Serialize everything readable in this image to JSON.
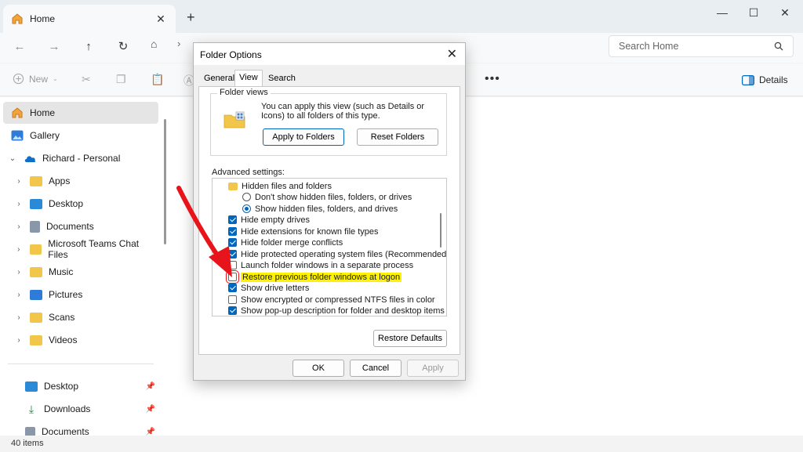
{
  "window": {
    "tab_title": "Home",
    "tab_close": "✕",
    "new_tab": "+",
    "minimize": "—",
    "maximize": "☐",
    "close": "✕"
  },
  "nav": {
    "back": "←",
    "forward": "→",
    "up": "↑",
    "refresh": "↻",
    "home": "⌂",
    "chevron": "›",
    "search_placeholder": "Search Home"
  },
  "commands": {
    "new_label": "New",
    "more": "•••",
    "details_label": "Details"
  },
  "sidebar": {
    "items": [
      {
        "label": "Home",
        "icon": "home-icon",
        "selected": true
      },
      {
        "label": "Gallery",
        "icon": "gallery-icon"
      },
      {
        "label": "Richard - Personal",
        "icon": "onedrive-icon",
        "expanded": true
      },
      {
        "label": "Apps",
        "icon": "folder-icon"
      },
      {
        "label": "Desktop",
        "icon": "desktop-icon"
      },
      {
        "label": "Documents",
        "icon": "documents-icon"
      },
      {
        "label": "Microsoft Teams Chat Files",
        "icon": "folder-icon"
      },
      {
        "label": "Music",
        "icon": "folder-icon"
      },
      {
        "label": "Pictures",
        "icon": "pictures-icon"
      },
      {
        "label": "Scans",
        "icon": "folder-icon"
      },
      {
        "label": "Videos",
        "icon": "folder-icon"
      }
    ],
    "pinned": [
      {
        "label": "Desktop",
        "icon": "desktop-icon"
      },
      {
        "label": "Downloads",
        "icon": "download-icon"
      },
      {
        "label": "Documents",
        "icon": "documents-icon"
      }
    ]
  },
  "status": {
    "item_count": "40 items"
  },
  "dialog": {
    "title": "Folder Options",
    "close": "✕",
    "tabs": [
      "General",
      "View",
      "Search"
    ],
    "active_tab": "View",
    "folder_views": {
      "legend": "Folder views",
      "description": "You can apply this view (such as Details or Icons) to all folders of this type.",
      "apply_button": "Apply to Folders",
      "reset_button": "Reset Folders"
    },
    "advanced_label": "Advanced settings:",
    "advanced": [
      {
        "label": "Hidden files and folders",
        "kind": "folder"
      },
      {
        "label": "Don't show hidden files, folders, or drives",
        "kind": "radio",
        "checked": false
      },
      {
        "label": "Show hidden files, folders, and drives",
        "kind": "radio",
        "checked": true
      },
      {
        "label": "Hide empty drives",
        "kind": "checkbox",
        "checked": true
      },
      {
        "label": "Hide extensions for known file types",
        "kind": "checkbox",
        "checked": true
      },
      {
        "label": "Hide folder merge conflicts",
        "kind": "checkbox",
        "checked": true
      },
      {
        "label": "Hide protected operating system files (Recommended)",
        "kind": "checkbox",
        "checked": true
      },
      {
        "label": "Launch folder windows in a separate process",
        "kind": "checkbox",
        "checked": false
      },
      {
        "label": "Restore previous folder windows at logon",
        "kind": "checkbox",
        "checked": false,
        "highlighted": true
      },
      {
        "label": "Show drive letters",
        "kind": "checkbox",
        "checked": true
      },
      {
        "label": "Show encrypted or compressed NTFS files in color",
        "kind": "checkbox",
        "checked": false
      },
      {
        "label": "Show pop-up description for folder and desktop items",
        "kind": "checkbox",
        "checked": true
      }
    ],
    "restore_defaults": "Restore Defaults",
    "ok": "OK",
    "cancel": "Cancel",
    "apply": "Apply"
  },
  "colors": {
    "accent": "#0067c0",
    "highlight": "#fff200",
    "arrow": "#e8141c",
    "folder": "#f2c54b"
  }
}
